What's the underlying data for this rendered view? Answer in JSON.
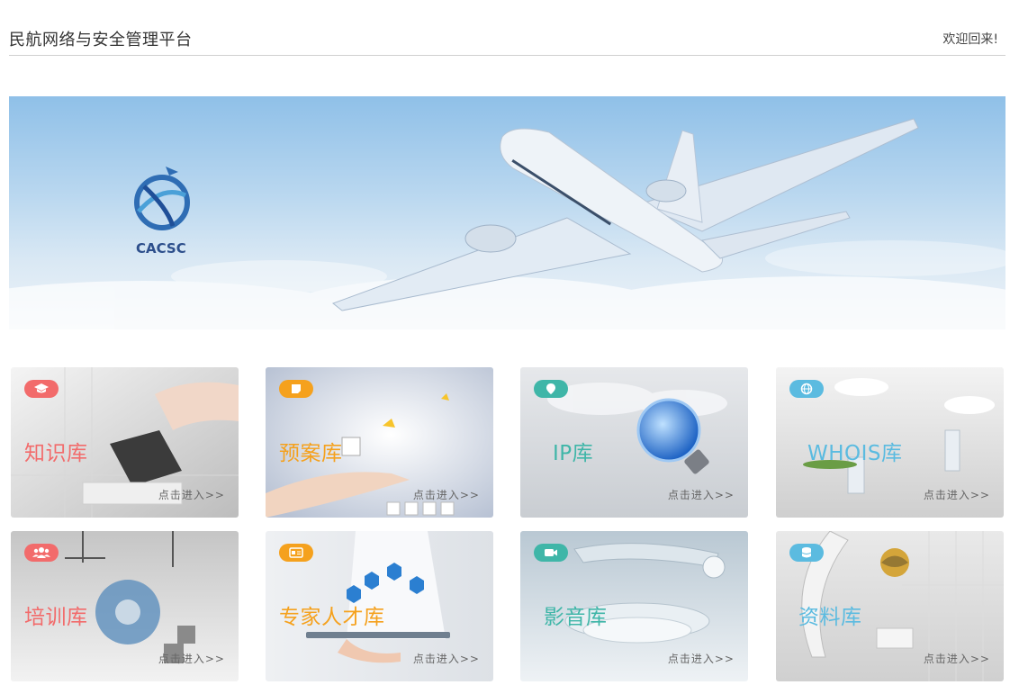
{
  "header": {
    "title": "民航网络与安全管理平台",
    "welcome": "欢迎回来!"
  },
  "banner": {
    "logo_text": "CACSC"
  },
  "cards": [
    {
      "name": "知识库",
      "enter": "点击进入>>",
      "icon": "graduation-cap-icon",
      "color": "#f26b6b"
    },
    {
      "name": "预案库",
      "enter": "点击进入>>",
      "icon": "note-icon",
      "color": "#f5a11d"
    },
    {
      "name": "IP库",
      "enter": "点击进入>>",
      "icon": "location-pin-icon",
      "color": "#3fb6a8"
    },
    {
      "name": "WHOIS库",
      "enter": "点击进入>>",
      "icon": "globe-icon",
      "color": "#5bbbe0"
    },
    {
      "name": "培训库",
      "enter": "点击进入>>",
      "icon": "people-icon",
      "color": "#f26b6b"
    },
    {
      "name": "专家人才库",
      "enter": "点击进入>>",
      "icon": "id-card-icon",
      "color": "#f5a11d"
    },
    {
      "name": "影音库",
      "enter": "点击进入>>",
      "icon": "video-camera-icon",
      "color": "#3fb6a8"
    },
    {
      "name": "资料库",
      "enter": "点击进入>>",
      "icon": "database-icon",
      "color": "#5bbbe0"
    }
  ]
}
